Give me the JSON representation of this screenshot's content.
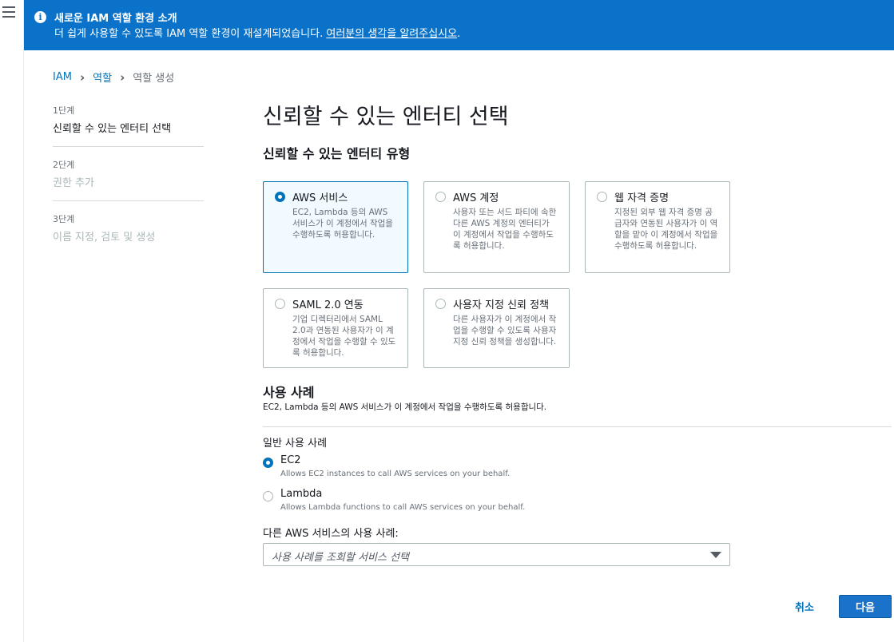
{
  "banner": {
    "icon": "info-icon",
    "title": "새로운 IAM 역할 환경 소개",
    "text": "더 쉽게 사용할 수 있도록 IAM 역할 환경이 재설계되었습니다. ",
    "link": "여러분의 생각을 알려주십시오",
    "suffix": ".",
    "color": "#0a73c9"
  },
  "breadcrumb": {
    "items": [
      "IAM",
      "역할",
      "역할 생성"
    ]
  },
  "steps": [
    {
      "num": "1단계",
      "label": "신뢰할 수 있는 엔터티 선택"
    },
    {
      "num": "2단계",
      "label": "권한 추가"
    },
    {
      "num": "3단계",
      "label": "이름 지정, 검토 및 생성"
    }
  ],
  "page_title": "신뢰할 수 있는 엔터티 선택",
  "entity_section_title": "신뢰할 수 있는 엔터티 유형",
  "entity_types": [
    {
      "title": "AWS 서비스",
      "desc": "EC2, Lambda 등의 AWS 서비스가 이 계정에서 작업을 수행하도록 허용합니다.",
      "selected": true
    },
    {
      "title": "AWS 계정",
      "desc": "사용자 또는 서드 파티에 속한 다른 AWS 계정의 엔터티가 이 계정에서 작업을 수행하도록 허용합니다.",
      "selected": false
    },
    {
      "title": "웹 자격 증명",
      "desc": "지정된 외부 웹 자격 증명 공급자와 연동된 사용자가 이 역할을 맡아 이 계정에서 작업을 수행하도록 허용합니다.",
      "selected": false
    },
    {
      "title": "SAML 2.0 연동",
      "desc": "기업 디렉터리에서 SAML 2.0과 연동된 사용자가 이 계정에서 작업을 수행할 수 있도록 허용합니다.",
      "selected": false
    },
    {
      "title": "사용자 지정 신뢰 정책",
      "desc": "다른 사용자가 이 계정에서 작업을 수행할 수 있도록 사용자 지정 신뢰 정책을 생성합니다.",
      "selected": false
    }
  ],
  "use_case": {
    "title": "사용 사례",
    "desc": "EC2, Lambda 등의 AWS 서비스가 이 계정에서 작업을 수행하도록 허용합니다.",
    "general_label": "일반 사용 사례",
    "options": [
      {
        "title": "EC2",
        "desc": "Allows EC2 instances to call AWS services on your behalf.",
        "selected": true
      },
      {
        "title": "Lambda",
        "desc": "Allows Lambda functions to call AWS services on your behalf.",
        "selected": false
      }
    ],
    "other_label": "다른 AWS 서비스의 사용 사례:",
    "select_placeholder": "사용 사례를 조회할 서비스 선택"
  },
  "actions": {
    "cancel": "취소",
    "next": "다음"
  }
}
